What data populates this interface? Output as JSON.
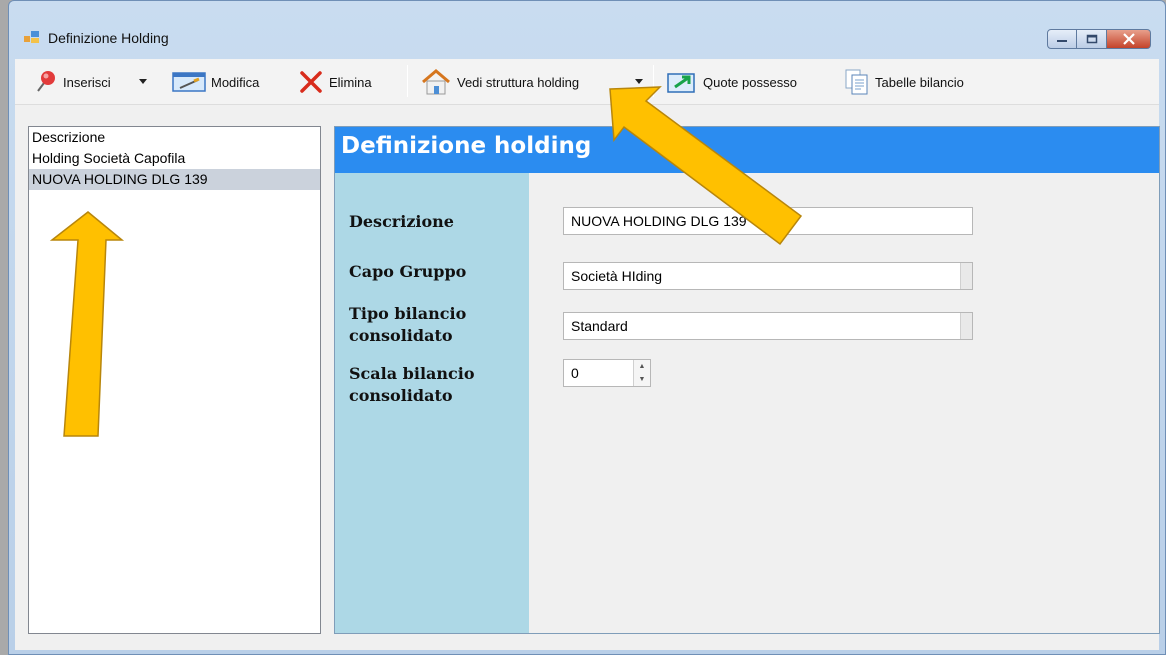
{
  "window": {
    "title": "Definizione Holding",
    "controls": [
      "minimize",
      "maximize",
      "close"
    ]
  },
  "toolbar": {
    "items": [
      {
        "label": "Inserisci",
        "icon": "pushpin-icon",
        "has_dropdown": true
      },
      {
        "label": "Modifica",
        "icon": "edit-icon"
      },
      {
        "label": "Elimina",
        "icon": "delete-x-icon"
      },
      {
        "label": "Vedi struttura holding",
        "icon": "house-icon",
        "has_dropdown": true
      },
      {
        "label": "Quote possesso",
        "icon": "export-arrow-icon"
      },
      {
        "label": "Tabelle bilancio",
        "icon": "documents-icon"
      }
    ]
  },
  "list": {
    "items": [
      {
        "label": "Descrizione"
      },
      {
        "label": "Holding Società Capofila"
      },
      {
        "label": "NUOVA HOLDING DLG 139",
        "selected": true
      }
    ]
  },
  "panel": {
    "title": "Definizione holding",
    "fields": {
      "descrizione": {
        "label": "Descrizione",
        "value": "NUOVA HOLDING DLG 139"
      },
      "capo_gruppo": {
        "label": "Capo Gruppo",
        "value": "Società HIding"
      },
      "tipo_bilancio": {
        "label_line1": "Tipo bilancio",
        "label_line2": "consolidato",
        "value": "Standard"
      },
      "scala_bilancio": {
        "label_line1": "Scala bilancio",
        "label_line2": "consolidato",
        "value": "0"
      }
    }
  },
  "colors": {
    "panel_header": "#2b8cf0",
    "panel_side": "#add8e6",
    "annotation_arrow": "#ffc000"
  }
}
